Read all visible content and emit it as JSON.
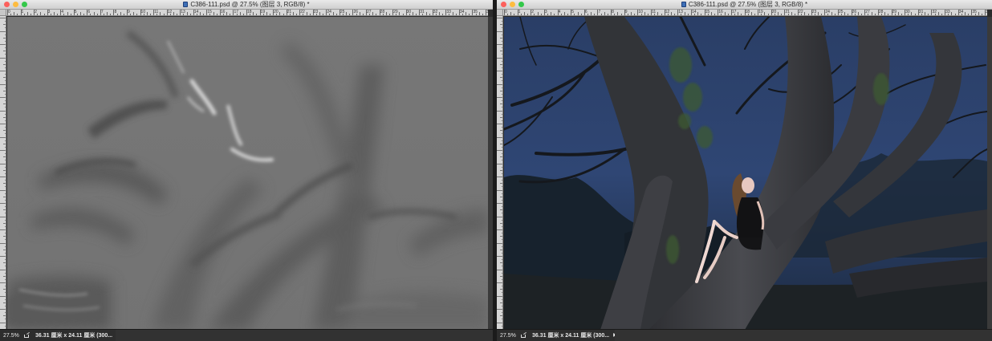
{
  "left_window": {
    "title": "C386-111.psd @ 27.5% (图层 3, RGB/8) *",
    "zoom": "27.5%",
    "doc_info": "36.31 厘米 x 24.11 厘米 (300...",
    "ruler_labels": [
      "0",
      "1",
      "2",
      "3",
      "4",
      "5",
      "6",
      "7",
      "8",
      "9",
      "10",
      "11",
      "12",
      "13",
      "14",
      "15",
      "16",
      "17",
      "18",
      "19",
      "20",
      "21",
      "22",
      "23",
      "24",
      "25",
      "26",
      "27",
      "28",
      "29",
      "30",
      "31",
      "32",
      "33",
      "34",
      "35",
      "36"
    ]
  },
  "right_window": {
    "title": "C386-111.psd @ 27.5% (图层 3, RGB/8) *",
    "zoom": "27.5%",
    "doc_info": "36.31 厘米 x 24.11 厘米 (300...",
    "ruler_labels": [
      "0",
      "1",
      "2",
      "3",
      "4",
      "5",
      "6",
      "7",
      "8",
      "9",
      "10",
      "11",
      "12",
      "13",
      "14",
      "15",
      "16",
      "17",
      "18",
      "19",
      "20",
      "21",
      "22",
      "23",
      "24",
      "25",
      "26",
      "27",
      "28",
      "29",
      "30",
      "31",
      "32",
      "33",
      "34",
      "35",
      "36"
    ]
  },
  "icons": {
    "close": "close-light-icon",
    "minimize": "minimize-light-icon",
    "zoom": "zoom-light-icon",
    "document": "psd-document-icon",
    "share": "share-icon",
    "status_menu": "triangle-right-icon"
  },
  "colors": {
    "titlebar": "#dcdcdc",
    "ruler": "#d6d6d6",
    "statusbar": "#2d2d2d",
    "close": "#fc605c",
    "minimize": "#fdbc40",
    "zoom": "#34c84a"
  }
}
